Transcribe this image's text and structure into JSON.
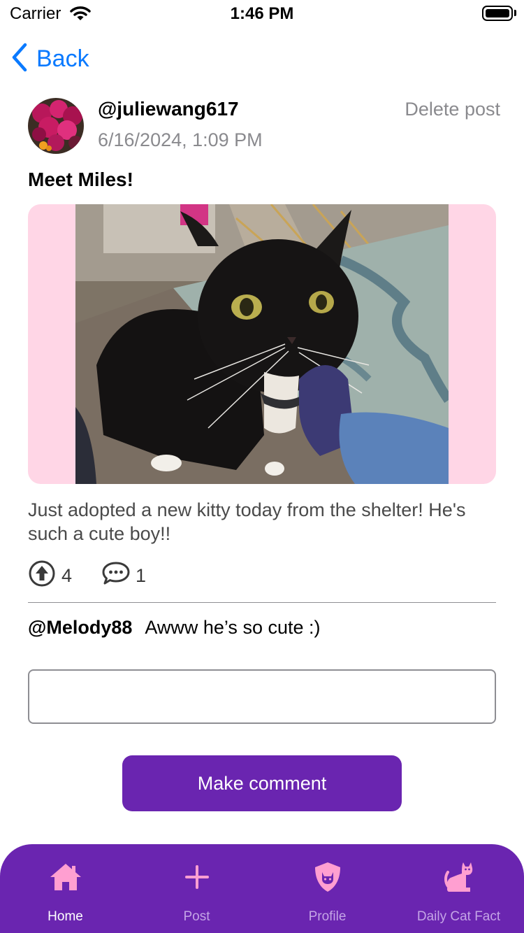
{
  "status_bar": {
    "carrier": "Carrier",
    "time": "1:46 PM"
  },
  "nav": {
    "back_label": "Back"
  },
  "post": {
    "username": "@juliewang617",
    "timestamp": "6/16/2024, 1:09 PM",
    "delete_label": "Delete post",
    "title": "Meet Miles!",
    "body": "Just adopted a new kitty today from the shelter! He's such a cute boy!!",
    "upvotes": "4",
    "comment_count": "1"
  },
  "comments": [
    {
      "author": "@Melody88",
      "text": "Awww he’s so cute :)"
    }
  ],
  "comment_input": {
    "value": "",
    "placeholder": ""
  },
  "make_comment_label": "Make comment",
  "tabs": [
    {
      "label": "Home",
      "icon": "home-icon",
      "active": true
    },
    {
      "label": "Post",
      "icon": "plus-icon",
      "active": false
    },
    {
      "label": "Profile",
      "icon": "shield-cat-icon",
      "active": false
    },
    {
      "label": "Daily Cat Fact",
      "icon": "cat-icon",
      "active": false
    }
  ],
  "colors": {
    "accent": "#6a25b0",
    "link": "#0a7aff",
    "photo_background": "#ffd6e6",
    "tab_icon": "#ff9fd1",
    "tab_inactive_label": "#c4a4e6"
  }
}
